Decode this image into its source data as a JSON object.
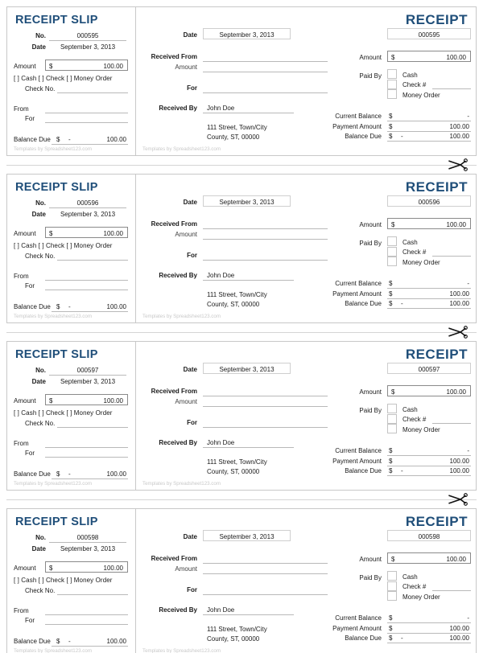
{
  "document": {
    "type": "receipt-template-sheet",
    "accent_color": "#1F4E79",
    "footer_note": "Templates by Spreadsheet123.com"
  },
  "slip": {
    "title": "RECEIPT SLIP",
    "no_label": "No.",
    "date_label": "Date",
    "amount_label": "Amount",
    "payment_options": "[ ] Cash     [ ] Check   [ ] Money Order",
    "check_no_label": "Check No.",
    "from_label": "From",
    "for_label": "For",
    "balance_due_label": "Balance Due",
    "currency": "$",
    "dash": "-"
  },
  "receipt": {
    "title": "RECEIPT",
    "date_label": "Date",
    "received_from_label": "Received From",
    "amount_label": "Amount",
    "for_label": "For",
    "received_by_label": "Received By",
    "amount_box_label": "Amount",
    "paid_by_label": "Paid By",
    "paid_by_options": [
      "Cash",
      "Check #",
      "Money Order"
    ],
    "current_balance_label": "Current Balance",
    "payment_amount_label": "Payment Amount",
    "balance_due_label": "Balance Due",
    "currency": "$",
    "dash": "-"
  },
  "shared_values": {
    "date": "September 3, 2013",
    "amount": "100.00",
    "received_by": "John Doe",
    "address_line1": "111 Street, Town/City",
    "address_line2": "County, ST, 00000",
    "current_balance": "-",
    "payment_amount": "100.00",
    "balance_due": "100.00"
  },
  "receipts": [
    {
      "number": "000595"
    },
    {
      "number": "000596"
    },
    {
      "number": "000597"
    },
    {
      "number": "000598"
    }
  ],
  "cut_lines": [
    {
      "icon": "scissors-icon"
    },
    {
      "icon": "scissors-icon"
    },
    {
      "icon": "scissors-icon"
    }
  ]
}
